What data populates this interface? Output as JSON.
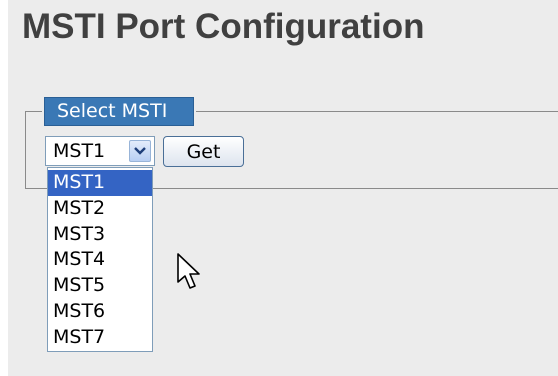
{
  "page": {
    "title": "MSTI Port Configuration"
  },
  "select_msti": {
    "legend": "Select MSTI",
    "selected_value": "MST1",
    "get_label": "Get",
    "options": [
      "MST1",
      "MST2",
      "MST3",
      "MST4",
      "MST5",
      "MST6",
      "MST7"
    ],
    "highlighted_option": "MST1"
  },
  "colors": {
    "legend_bg": "#3a78b5",
    "highlight_bg": "#3464c4",
    "panel_bg": "#ececec"
  },
  "icons": {
    "dropdown_arrow": "chevron-down-icon",
    "cursor": "mouse-pointer-icon"
  }
}
